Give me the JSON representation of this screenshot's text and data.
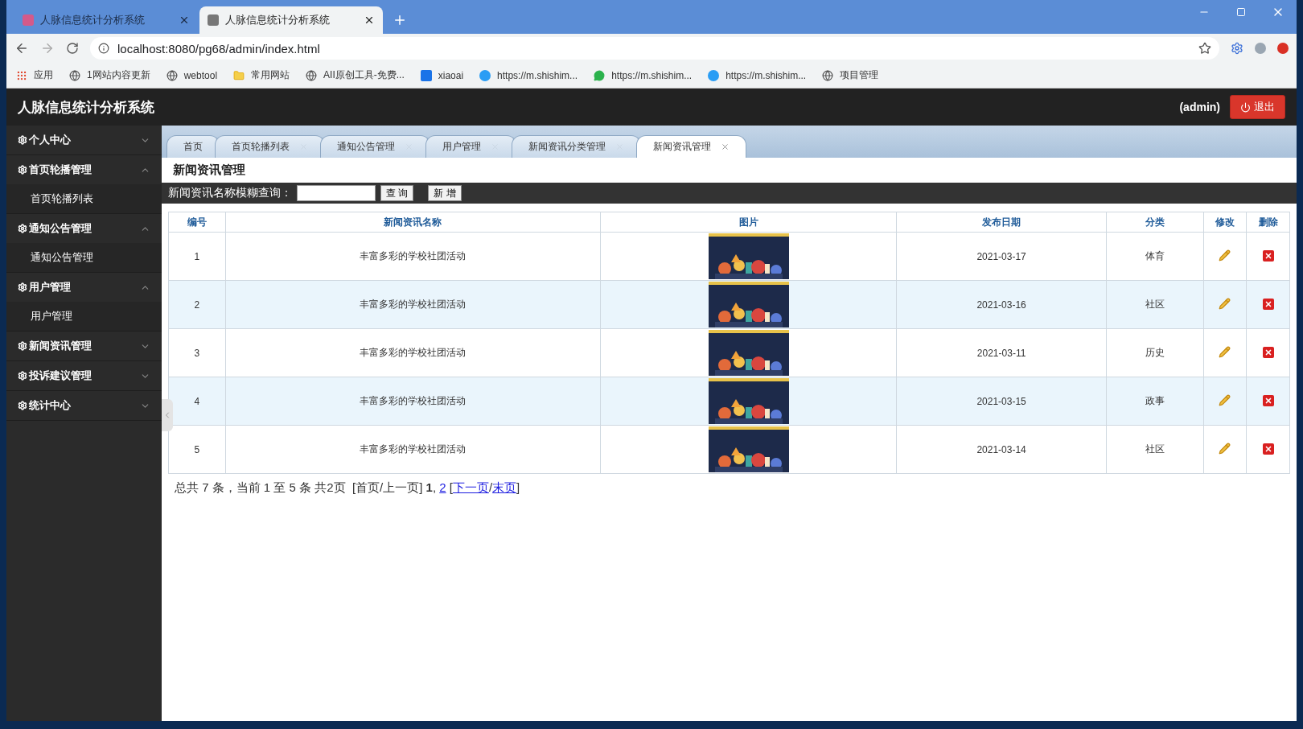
{
  "browser": {
    "tabs": [
      {
        "title": "人脉信息统计分析系统",
        "selected": false
      },
      {
        "title": "人脉信息统计分析系统",
        "selected": true
      }
    ],
    "url": "localhost:8080/pg68/admin/index.html",
    "bookmarks": [
      {
        "kind": "apps",
        "label": "应用"
      },
      {
        "kind": "globe",
        "label": "1网站内容更新"
      },
      {
        "kind": "globe",
        "label": "webtool"
      },
      {
        "kind": "folder",
        "label": "常用网站"
      },
      {
        "kind": "globe",
        "label": "AII原创工具-免费..."
      },
      {
        "kind": "p",
        "label": "xiaoai"
      },
      {
        "kind": "c",
        "label": "https://m.shishim..."
      },
      {
        "kind": "chat",
        "label": "https://m.shishim..."
      },
      {
        "kind": "c",
        "label": "https://m.shishim..."
      },
      {
        "kind": "globe",
        "label": "项目管理"
      }
    ]
  },
  "app": {
    "title": "人脉信息统计分析系统",
    "user": "(admin)",
    "logout": "退出"
  },
  "sidebar": {
    "items": [
      {
        "label": "个人中心",
        "expanded": false
      },
      {
        "label": "首页轮播管理",
        "expanded": true,
        "children": [
          {
            "label": "首页轮播列表"
          }
        ]
      },
      {
        "label": "通知公告管理",
        "expanded": true,
        "children": [
          {
            "label": "通知公告管理"
          }
        ]
      },
      {
        "label": "用户管理",
        "expanded": true,
        "children": [
          {
            "label": "用户管理"
          }
        ]
      },
      {
        "label": "新闻资讯管理",
        "expanded": false
      },
      {
        "label": "投诉建议管理",
        "expanded": false
      },
      {
        "label": "统计中心",
        "expanded": false
      }
    ]
  },
  "tabs": [
    {
      "label": "首页",
      "selected": false
    },
    {
      "label": "首页轮播列表",
      "selected": false
    },
    {
      "label": "通知公告管理",
      "selected": false
    },
    {
      "label": "用户管理",
      "selected": false
    },
    {
      "label": "新闻资讯分类管理",
      "selected": false
    },
    {
      "label": "新闻资讯管理",
      "selected": true
    }
  ],
  "page_title": "新闻资讯管理",
  "search": {
    "label": "新闻资讯名称模糊查询：",
    "query_button": "查 询",
    "add_button": "新 增"
  },
  "table": {
    "columns": [
      "编号",
      "新闻资讯名称",
      "图片",
      "发布日期",
      "分类",
      "修改",
      "删除"
    ],
    "rows": [
      {
        "id": "1",
        "name": "丰富多彩的学校社团活动",
        "date": "2021-03-17",
        "category": "体育"
      },
      {
        "id": "2",
        "name": "丰富多彩的学校社团活动",
        "date": "2021-03-16",
        "category": "社区"
      },
      {
        "id": "3",
        "name": "丰富多彩的学校社团活动",
        "date": "2021-03-11",
        "category": "历史"
      },
      {
        "id": "4",
        "name": "丰富多彩的学校社团活动",
        "date": "2021-03-15",
        "category": "政事"
      },
      {
        "id": "5",
        "name": "丰富多彩的学校社团活动",
        "date": "2021-03-14",
        "category": "社区"
      }
    ]
  },
  "pagination": [
    {
      "kind": "text",
      "text": "总共 7 条，当前 1 至 5 条 共2页  [首页/上一页] "
    },
    {
      "kind": "current",
      "text": "1"
    },
    {
      "kind": "text",
      "text": ", "
    },
    {
      "kind": "link",
      "text": "2"
    },
    {
      "kind": "text",
      "text": " ["
    },
    {
      "kind": "link",
      "text": "下一页"
    },
    {
      "kind": "text",
      "text": "/"
    },
    {
      "kind": "link",
      "text": "末页"
    },
    {
      "kind": "text",
      "text": "]"
    }
  ]
}
